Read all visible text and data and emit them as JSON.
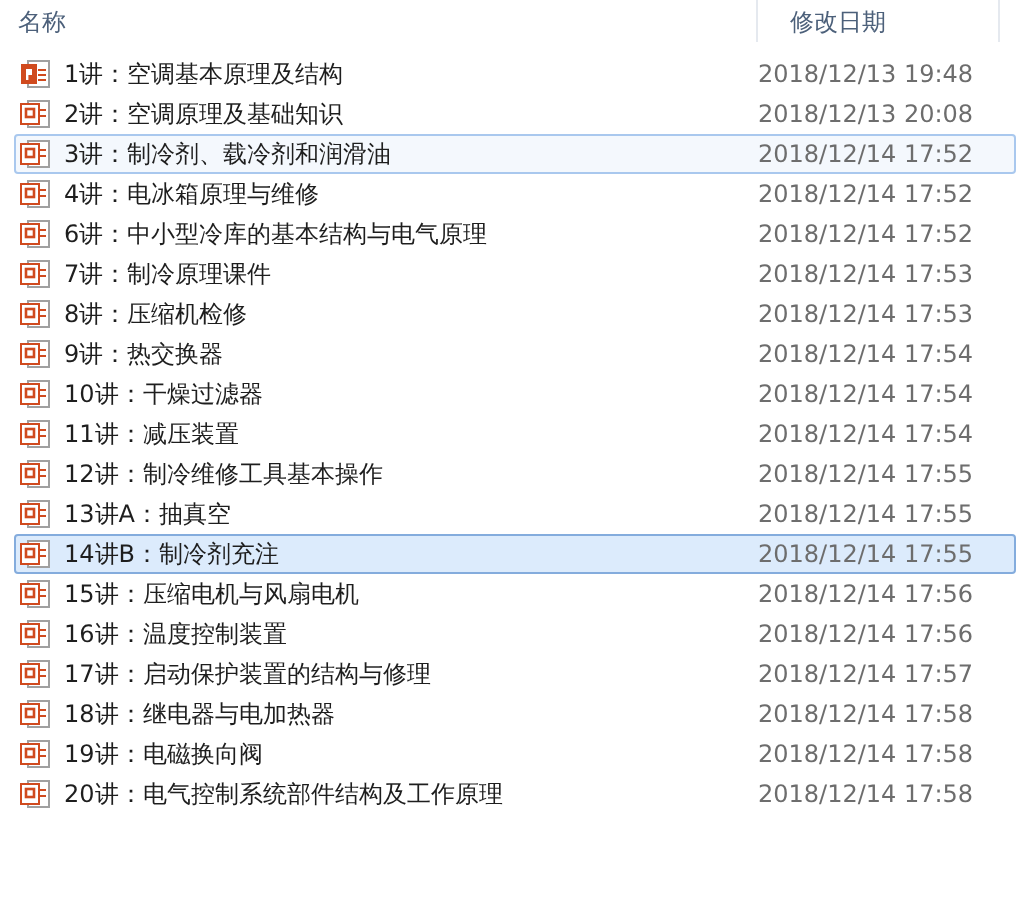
{
  "columns": [
    {
      "label": "名称"
    },
    {
      "label": "修改日期"
    }
  ],
  "rows": [
    {
      "name": "1讲：空调基本原理及结构",
      "date": "2018/12/13 19:48",
      "kind": "pptx",
      "selected": false,
      "focused": false
    },
    {
      "name": "2讲：空调原理及基础知识",
      "date": "2018/12/13 20:08",
      "kind": "ppt",
      "selected": false,
      "focused": false
    },
    {
      "name": "3讲：制冷剂、载冷剂和润滑油",
      "date": "2018/12/14 17:52",
      "kind": "ppt",
      "selected": false,
      "focused": true
    },
    {
      "name": "4讲：电冰箱原理与维修",
      "date": "2018/12/14 17:52",
      "kind": "ppt",
      "selected": false,
      "focused": false
    },
    {
      "name": "6讲：中小型冷库的基本结构与电气原理",
      "date": "2018/12/14 17:52",
      "kind": "ppt",
      "selected": false,
      "focused": false
    },
    {
      "name": "7讲：制冷原理课件",
      "date": "2018/12/14 17:53",
      "kind": "ppt",
      "selected": false,
      "focused": false
    },
    {
      "name": "8讲：压缩机检修",
      "date": "2018/12/14 17:53",
      "kind": "ppt",
      "selected": false,
      "focused": false
    },
    {
      "name": "9讲：热交换器",
      "date": "2018/12/14 17:54",
      "kind": "ppt",
      "selected": false,
      "focused": false
    },
    {
      "name": "10讲：干燥过滤器",
      "date": "2018/12/14 17:54",
      "kind": "ppt",
      "selected": false,
      "focused": false
    },
    {
      "name": "11讲：减压装置",
      "date": "2018/12/14 17:54",
      "kind": "ppt",
      "selected": false,
      "focused": false
    },
    {
      "name": "12讲：制冷维修工具基本操作",
      "date": "2018/12/14 17:55",
      "kind": "ppt",
      "selected": false,
      "focused": false
    },
    {
      "name": "13讲A：抽真空",
      "date": "2018/12/14 17:55",
      "kind": "ppt",
      "selected": false,
      "focused": false
    },
    {
      "name": "14讲B：制冷剂充注",
      "date": "2018/12/14 17:55",
      "kind": "ppt",
      "selected": true,
      "focused": false
    },
    {
      "name": "15讲：压缩电机与风扇电机",
      "date": "2018/12/14 17:56",
      "kind": "ppt",
      "selected": false,
      "focused": false
    },
    {
      "name": "16讲：温度控制装置",
      "date": "2018/12/14 17:56",
      "kind": "ppt",
      "selected": false,
      "focused": false
    },
    {
      "name": "17讲：启动保护装置的结构与修理",
      "date": "2018/12/14 17:57",
      "kind": "ppt",
      "selected": false,
      "focused": false
    },
    {
      "name": "18讲：继电器与电加热器",
      "date": "2018/12/14 17:58",
      "kind": "ppt",
      "selected": false,
      "focused": false
    },
    {
      "name": "19讲：电磁换向阀",
      "date": "2018/12/14 17:58",
      "kind": "ppt",
      "selected": false,
      "focused": false
    },
    {
      "name": "20讲：电气控制系统部件结构及工作原理",
      "date": "2018/12/14 17:58",
      "kind": "ppt",
      "selected": false,
      "focused": false
    }
  ]
}
